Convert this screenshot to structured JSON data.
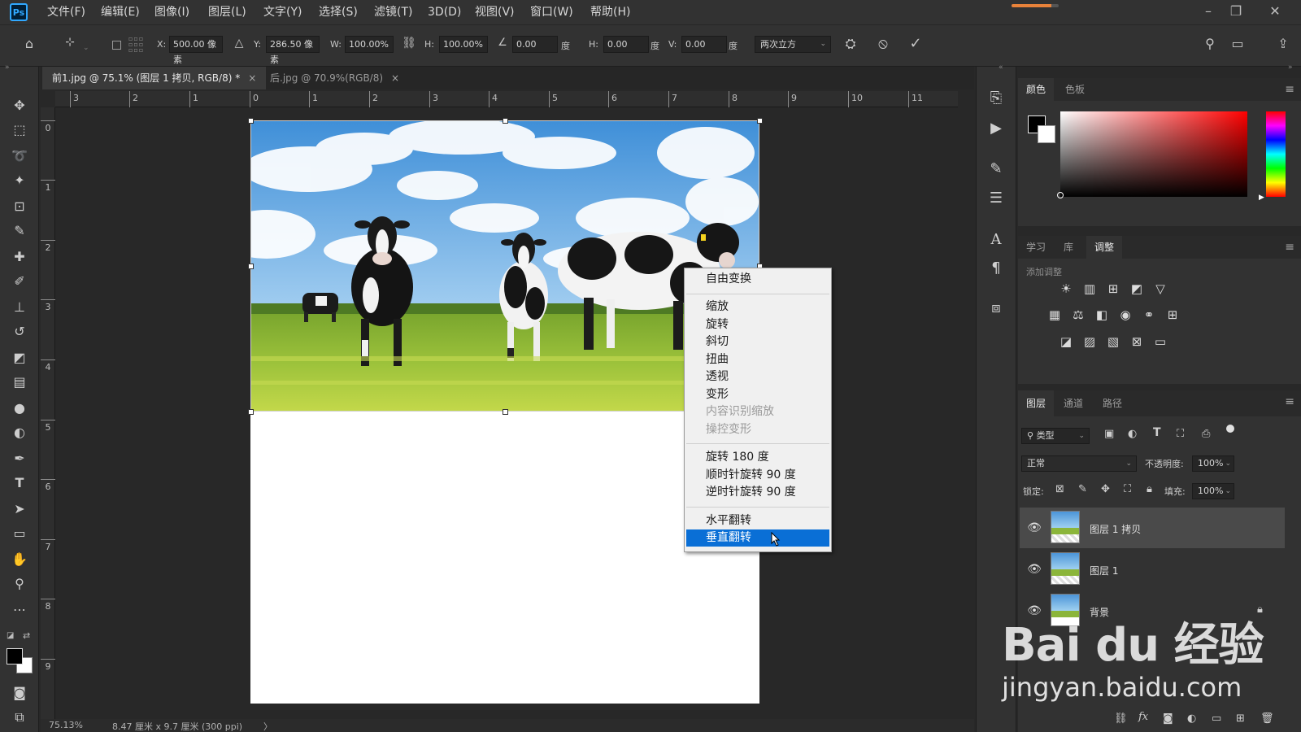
{
  "app": {
    "logo": "Ps",
    "menu": [
      "文件(F)",
      "编辑(E)",
      "图像(I)",
      "图层(L)",
      "文字(Y)",
      "选择(S)",
      "滤镜(T)",
      "3D(D)",
      "视图(V)",
      "窗口(W)",
      "帮助(H)"
    ],
    "progress": 0.85
  },
  "options": {
    "x_label": "X:",
    "x_value": "500.00 像素",
    "y_label": "Y:",
    "y_value": "286.50 像素",
    "w_label": "W:",
    "w_value": "100.00%",
    "h_label": "H:",
    "h_value": "100.00%",
    "angle_value": "0.00",
    "angle_unit": "度",
    "hskew_label": "H:",
    "hskew_value": "0.00",
    "hskew_unit": "度",
    "vskew_label": "V:",
    "vskew_value": "0.00",
    "vskew_unit": "度",
    "interpolation": "两次立方"
  },
  "tabs": [
    {
      "label": "前1.jpg @ 75.1% (图层 1 拷贝, RGB/8) *",
      "close": "×"
    },
    {
      "label": "后.jpg @ 70.9%(RGB/8)",
      "close": "×"
    }
  ],
  "ruler_h": [
    "3",
    "2",
    "1",
    "0",
    "1",
    "2",
    "3",
    "4",
    "5",
    "6",
    "7",
    "8",
    "9",
    "10",
    "11"
  ],
  "ruler_v": [
    "0",
    "1",
    "2",
    "3",
    "4",
    "5",
    "6",
    "7",
    "8",
    "9"
  ],
  "context_menu": {
    "items": [
      {
        "label": "自由变换",
        "state": "normal"
      },
      {
        "label": "缩放",
        "state": "normal"
      },
      {
        "label": "旋转",
        "state": "normal"
      },
      {
        "label": "斜切",
        "state": "normal"
      },
      {
        "label": "扭曲",
        "state": "normal"
      },
      {
        "label": "透视",
        "state": "normal"
      },
      {
        "label": "变形",
        "state": "normal"
      },
      {
        "label": "内容识别缩放",
        "state": "disabled"
      },
      {
        "label": "操控变形",
        "state": "disabled"
      },
      {
        "label": "旋转 180 度",
        "state": "normal"
      },
      {
        "label": "顺时针旋转 90 度",
        "state": "normal"
      },
      {
        "label": "逆时针旋转 90 度",
        "state": "normal"
      },
      {
        "label": "水平翻转",
        "state": "normal"
      },
      {
        "label": "垂直翻转",
        "state": "highlighted"
      }
    ]
  },
  "status": {
    "zoom": "75.13%",
    "doc_size": "8.47 厘米 x 9.7 厘米 (300 ppi)",
    "arrow": "〉"
  },
  "color_panel": {
    "tabs": [
      "颜色",
      "色板"
    ]
  },
  "adjust_panel": {
    "tabs": [
      "学习",
      "库",
      "调整"
    ],
    "add_label": "添加调整"
  },
  "layers_panel": {
    "tabs": [
      "图层",
      "通道",
      "路径"
    ],
    "filter_label": "类型",
    "blend_mode": "正常",
    "opacity_label": "不透明度:",
    "opacity_value": "100%",
    "lock_label": "锁定:",
    "fill_label": "填充:",
    "fill_value": "100%",
    "layers": [
      {
        "name": "图层 1 拷贝",
        "selected": true
      },
      {
        "name": "图层 1",
        "selected": false
      },
      {
        "name": "背景",
        "selected": false,
        "locked": true
      }
    ]
  },
  "watermark": {
    "logo": "Bai du 经验",
    "url": "jingyan.baidu.com"
  },
  "colors": {
    "accent": "#0a6fd6",
    "ps_blue": "#31a8ff",
    "panel_bg": "#323232"
  }
}
